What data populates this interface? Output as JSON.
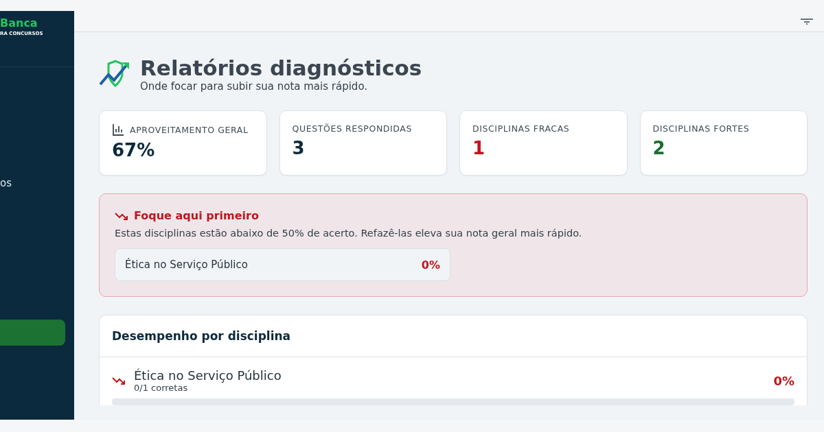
{
  "sidebar": {
    "logo": "Banca",
    "tagline": "RA CONCURSOS",
    "items": [
      {
        "label": "os",
        "selected": false
      },
      {
        "selected": true
      }
    ]
  },
  "header": {
    "title": "Relatórios diagnósticos",
    "subtitle": "Onde focar para subir sua nota mais rápido."
  },
  "stats": [
    {
      "kind": "icon",
      "label": "APROVEITAMENTO GERAL",
      "value": "67%",
      "color": "#0d2a3d"
    },
    {
      "kind": "plain",
      "label": "QUESTÕES RESPONDIDAS",
      "value": "3",
      "color": "#0d2a3d"
    },
    {
      "kind": "plain",
      "label": "DISCIPLINAS FRACAS",
      "value": "1",
      "color": "#c0161c"
    },
    {
      "kind": "plain",
      "label": "DISCIPLINAS FORTES",
      "value": "2",
      "color": "#1a6e2e"
    }
  ],
  "focus": {
    "title": "Foque aqui primeiro",
    "text": "Estas disciplinas estão abaixo de 50% de acerto. Refazê-las eleva sua nota geral mais rápido.",
    "items": [
      {
        "name": "Ética no Serviço Público",
        "score": "0%"
      }
    ]
  },
  "performance": {
    "title": "Desempenho por disciplina",
    "rows": [
      {
        "name": "Ética no Serviço Público",
        "detail": "0/1 corretas",
        "score": "0%"
      }
    ]
  }
}
